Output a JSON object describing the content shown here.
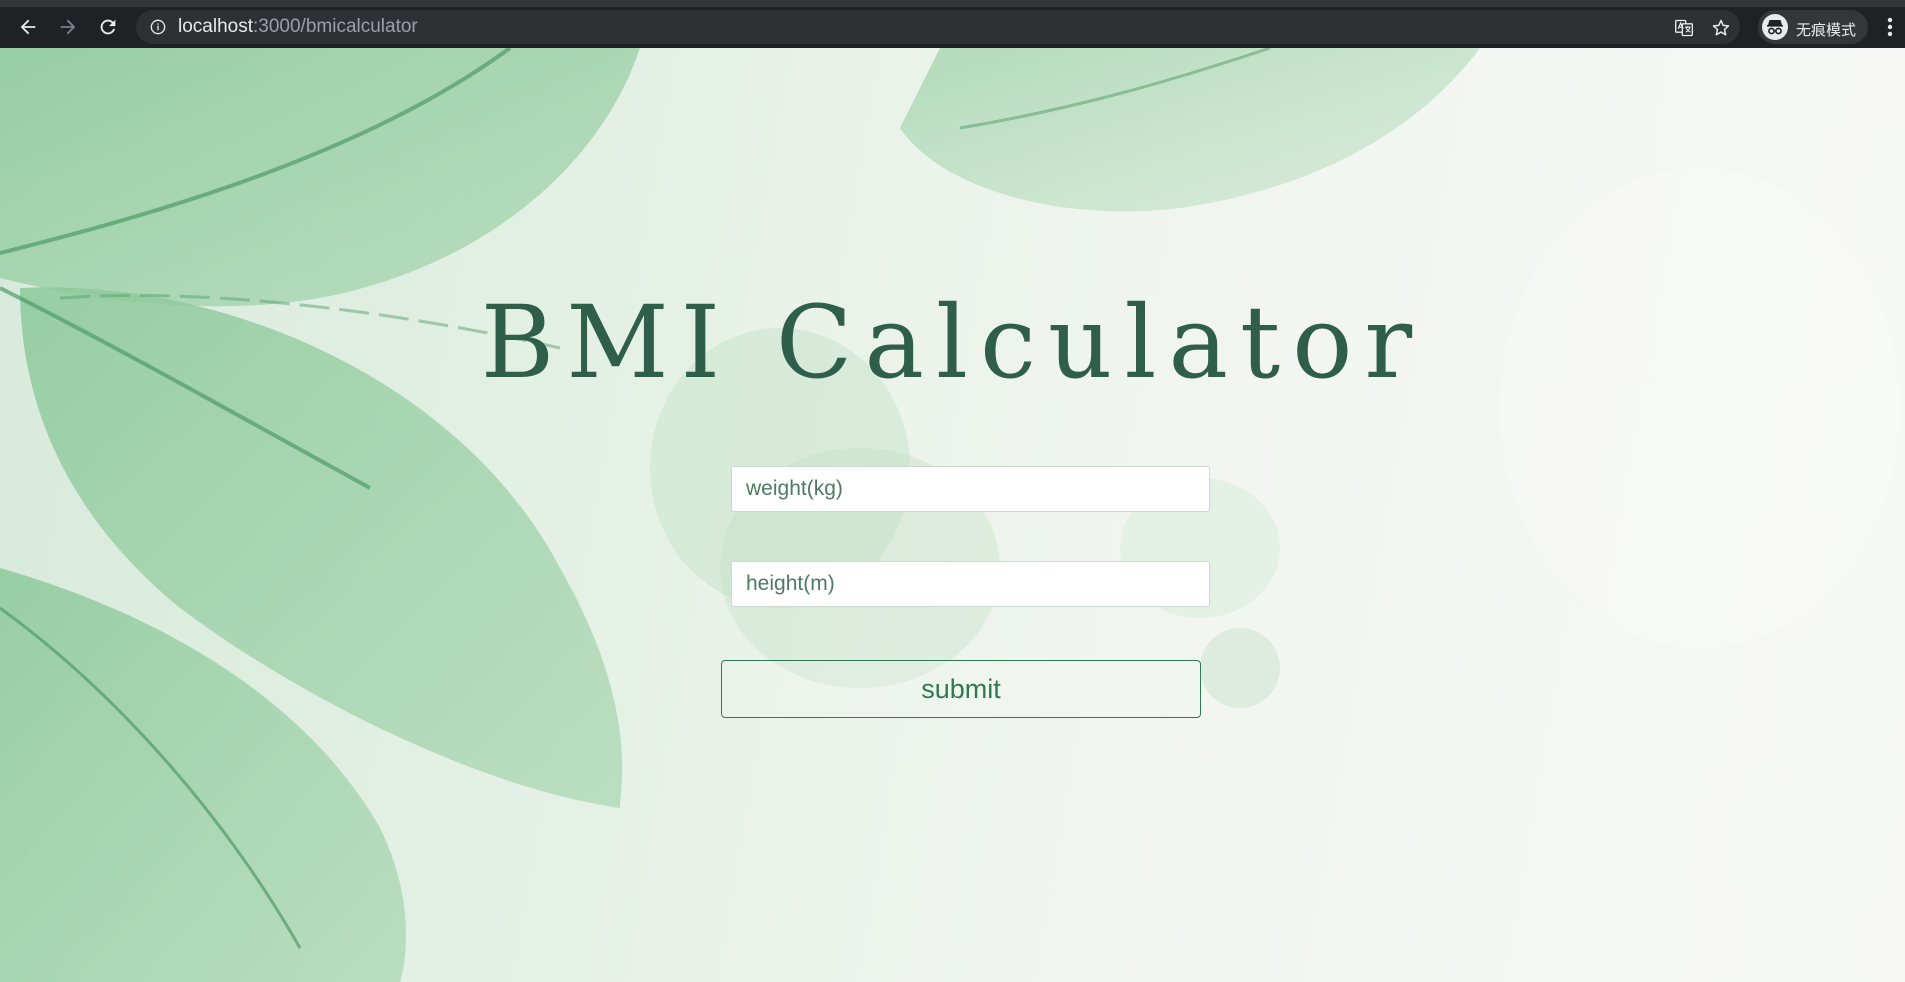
{
  "browser": {
    "url_host": "localhost",
    "url_path": ":3000/bmicalculator",
    "incognito_label": "无痕模式",
    "icons": [
      "back-arrow-icon",
      "forward-arrow-icon",
      "reload-icon",
      "info-icon",
      "translate-icon",
      "star-icon",
      "incognito-icon",
      "more-vert-icon"
    ]
  },
  "page": {
    "title": "BMI Calculator",
    "weight_placeholder": "weight(kg)",
    "height_placeholder": "height(m)",
    "submit_label": "submit"
  },
  "colors": {
    "title": "#2f5e4a",
    "accent": "#2f7a55",
    "leaf": "#7fbf8e"
  }
}
